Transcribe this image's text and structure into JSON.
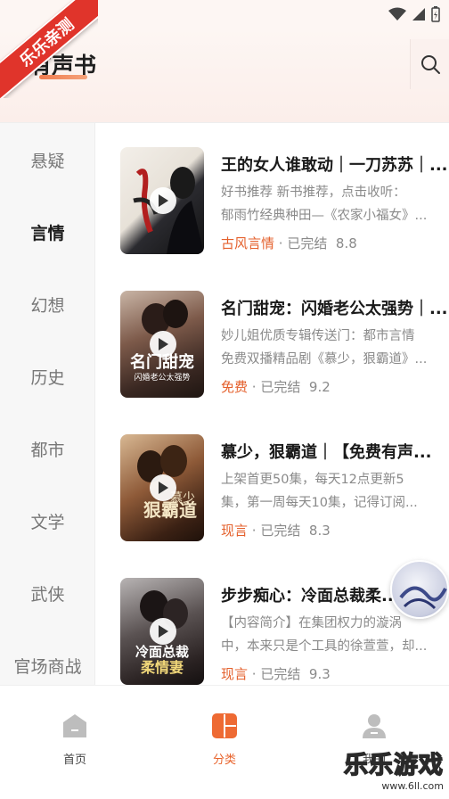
{
  "ribbon": {
    "text": "乐乐亲测"
  },
  "header": {
    "title": "有声书"
  },
  "sidebar": {
    "items": [
      {
        "label": "悬疑",
        "active": false
      },
      {
        "label": "言情",
        "active": true
      },
      {
        "label": "幻想",
        "active": false
      },
      {
        "label": "历史",
        "active": false
      },
      {
        "label": "都市",
        "active": false
      },
      {
        "label": "文学",
        "active": false
      },
      {
        "label": "武侠",
        "active": false
      },
      {
        "label": "官场商战",
        "active": false
      }
    ]
  },
  "books": [
    {
      "title": "王的女人谁敢动｜一刀苏苏｜...",
      "desc1": "好书推荐 新书推荐，点击收听：",
      "desc2": "郁雨竹经典种田—《农家小福女》...",
      "tag": "古风言情",
      "status": "已完结",
      "score": "8.8"
    },
    {
      "title": "名门甜宠：闪婚老公太强势｜...",
      "desc1": "妙儿姐优质专辑传送门：都市言情",
      "desc2": "免费双播精品剧《慕少，狠霸道》...",
      "tag": "免费",
      "status": "已完结",
      "score": "9.2"
    },
    {
      "title": "慕少，狠霸道｜【免费有声...",
      "desc1": "上架首更50集，每天12点更新5",
      "desc2": "集，第一周每天10集，记得订阅...",
      "tag": "现言",
      "status": "已完结",
      "score": "8.3"
    },
    {
      "title": "步步痴心：冷面总裁柔...",
      "desc1": "【内容简介】在集团权力的漩涡",
      "desc2": "中，本来只是个工具的徐萱萱，却...",
      "tag": "现言",
      "status": "已完结",
      "score": "9.3"
    }
  ],
  "meta_separator": "·",
  "tabbar": {
    "items": [
      {
        "label": "首页",
        "active": false
      },
      {
        "label": "分类",
        "active": true
      },
      {
        "label": "我的",
        "active": false
      }
    ]
  },
  "watermark": {
    "big": "乐乐游戏",
    "small": "www.6ll.com"
  },
  "colors": {
    "accent": "#e8642d",
    "ribbon": "#e0342b"
  }
}
